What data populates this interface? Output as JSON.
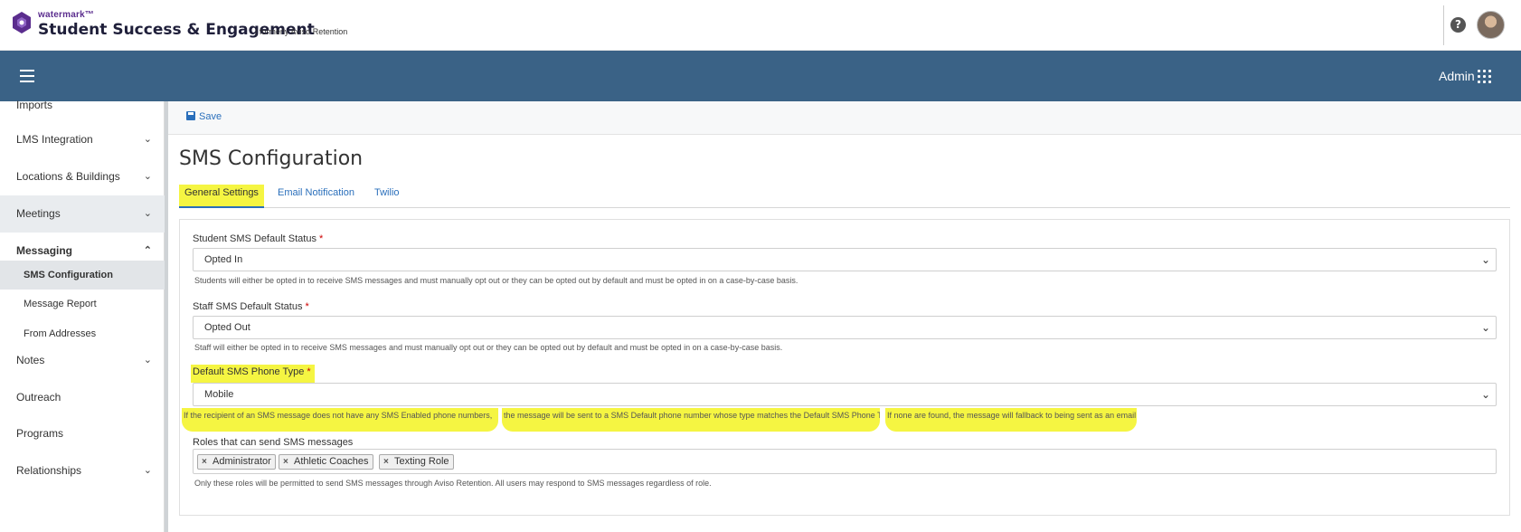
{
  "header": {
    "brand_small": "watermark™",
    "brand_main": "Student Success & Engagement",
    "brand_former": "| formerly Aviso Retention",
    "help_icon": "question-circle-icon",
    "avatar_icon": "user-avatar"
  },
  "navbar": {
    "menu_icon": "hamburger-icon",
    "admin_label": "Admin",
    "apps_icon": "grid-apps-icon",
    "color": "#3a6286"
  },
  "sidebar": {
    "items": [
      {
        "label": "Imports"
      },
      {
        "label": "LMS Integration"
      },
      {
        "label": "Locations & Buildings"
      },
      {
        "label": "Meetings"
      },
      {
        "label": "Messaging"
      },
      {
        "label": "SMS Configuration"
      },
      {
        "label": "Message Report"
      },
      {
        "label": "From Addresses"
      },
      {
        "label": "Notes"
      },
      {
        "label": "Outreach"
      },
      {
        "label": "Programs"
      },
      {
        "label": "Relationships"
      }
    ]
  },
  "toolbar": {
    "save_label": "Save"
  },
  "page": {
    "title": "SMS Configuration"
  },
  "tabs": [
    {
      "label": "General Settings"
    },
    {
      "label": "Email Notification"
    },
    {
      "label": "Twilio"
    }
  ],
  "form": {
    "student_status": {
      "label": "Student SMS Default Status",
      "required": "*",
      "value": "Opted In",
      "help": "Students will either be opted in to receive SMS messages and must manually opt out or they can be opted out by default and must be opted in on a case-by-case basis."
    },
    "staff_status": {
      "label": "Staff SMS Default Status",
      "required": "*",
      "value": "Opted Out",
      "help": "Staff will either be opted in to receive SMS messages and must manually opt out or they can be opted out by default and must be opted in on a case-by-case basis."
    },
    "phone_type": {
      "label": "Default SMS Phone Type",
      "required": "*",
      "value": "Mobile",
      "help_part1": "If the recipient of an SMS message does not have any SMS Enabled phone numbers,",
      "help_part2": "the message will be sent to a SMS Default phone number whose type matches the Default SMS Phone Type.",
      "help_part3": "If none are found, the message will fallback to being sent as an email"
    },
    "roles": {
      "label": "Roles that can send SMS messages",
      "chips": [
        "Administrator",
        "Athletic Coaches",
        "Texting Role"
      ],
      "help": "Only these roles will be permitted to send SMS messages through Aviso Retention. All users may respond to SMS messages regardless of role."
    }
  },
  "colors": {
    "highlight": "#f5f542",
    "link": "#2a6fbb"
  }
}
